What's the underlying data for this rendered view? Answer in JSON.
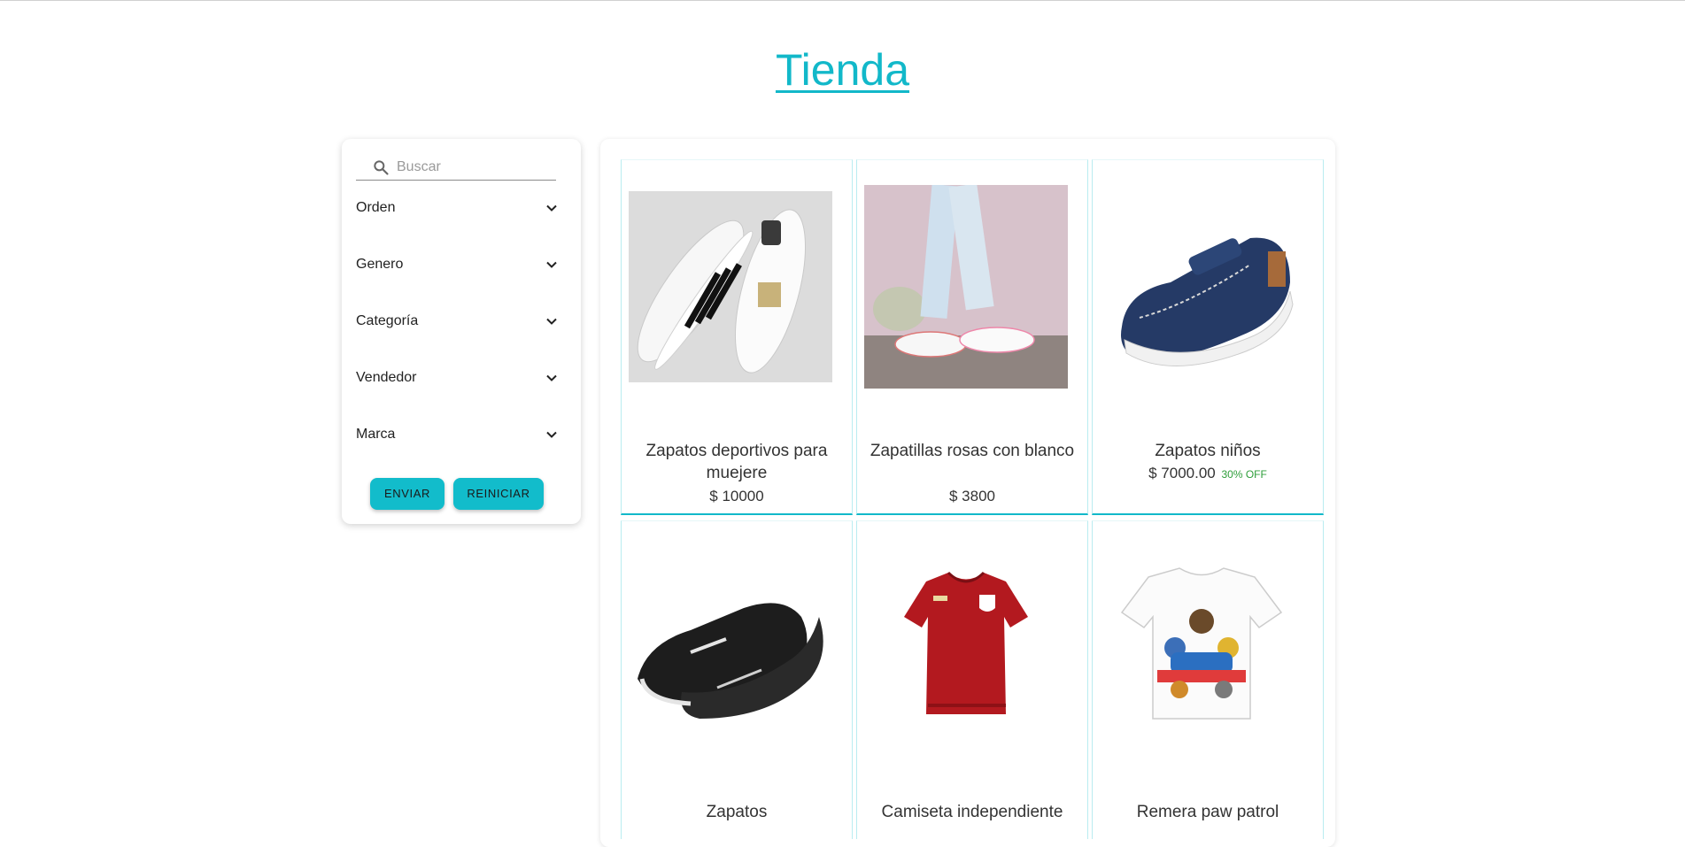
{
  "page": {
    "title": "Tienda"
  },
  "search": {
    "placeholder": "Buscar",
    "value": ""
  },
  "filters": [
    {
      "label": "Orden"
    },
    {
      "label": "Genero"
    },
    {
      "label": "Categoría"
    },
    {
      "label": "Vendedor"
    },
    {
      "label": "Marca"
    }
  ],
  "buttons": {
    "submit": "ENVIAR",
    "reset": "REINICIAR"
  },
  "colors": {
    "accent": "#12b8c9",
    "discount": "#2e9e3a"
  },
  "products": [
    {
      "name": "Zapatos deportivos para muejere",
      "price": "$ 10000",
      "discount": "",
      "image": "white-black-striped-sneakers"
    },
    {
      "name": "Zapatillas rosas con blanco",
      "price": "$ 3800",
      "discount": "",
      "image": "pink-white-sneakers-on-feet"
    },
    {
      "name": "Zapatos niños",
      "price": "$ 7000.00",
      "discount": "30% OFF",
      "image": "navy-kids-boat-shoe"
    },
    {
      "name": "Zapatos",
      "price": "",
      "discount": "",
      "image": "black-high-top-sneakers"
    },
    {
      "name": "Camiseta independiente",
      "price": "",
      "discount": "",
      "image": "red-football-shirt"
    },
    {
      "name": "Remera paw patrol",
      "price": "",
      "discount": "",
      "image": "white-paw-patrol-tshirt"
    }
  ]
}
